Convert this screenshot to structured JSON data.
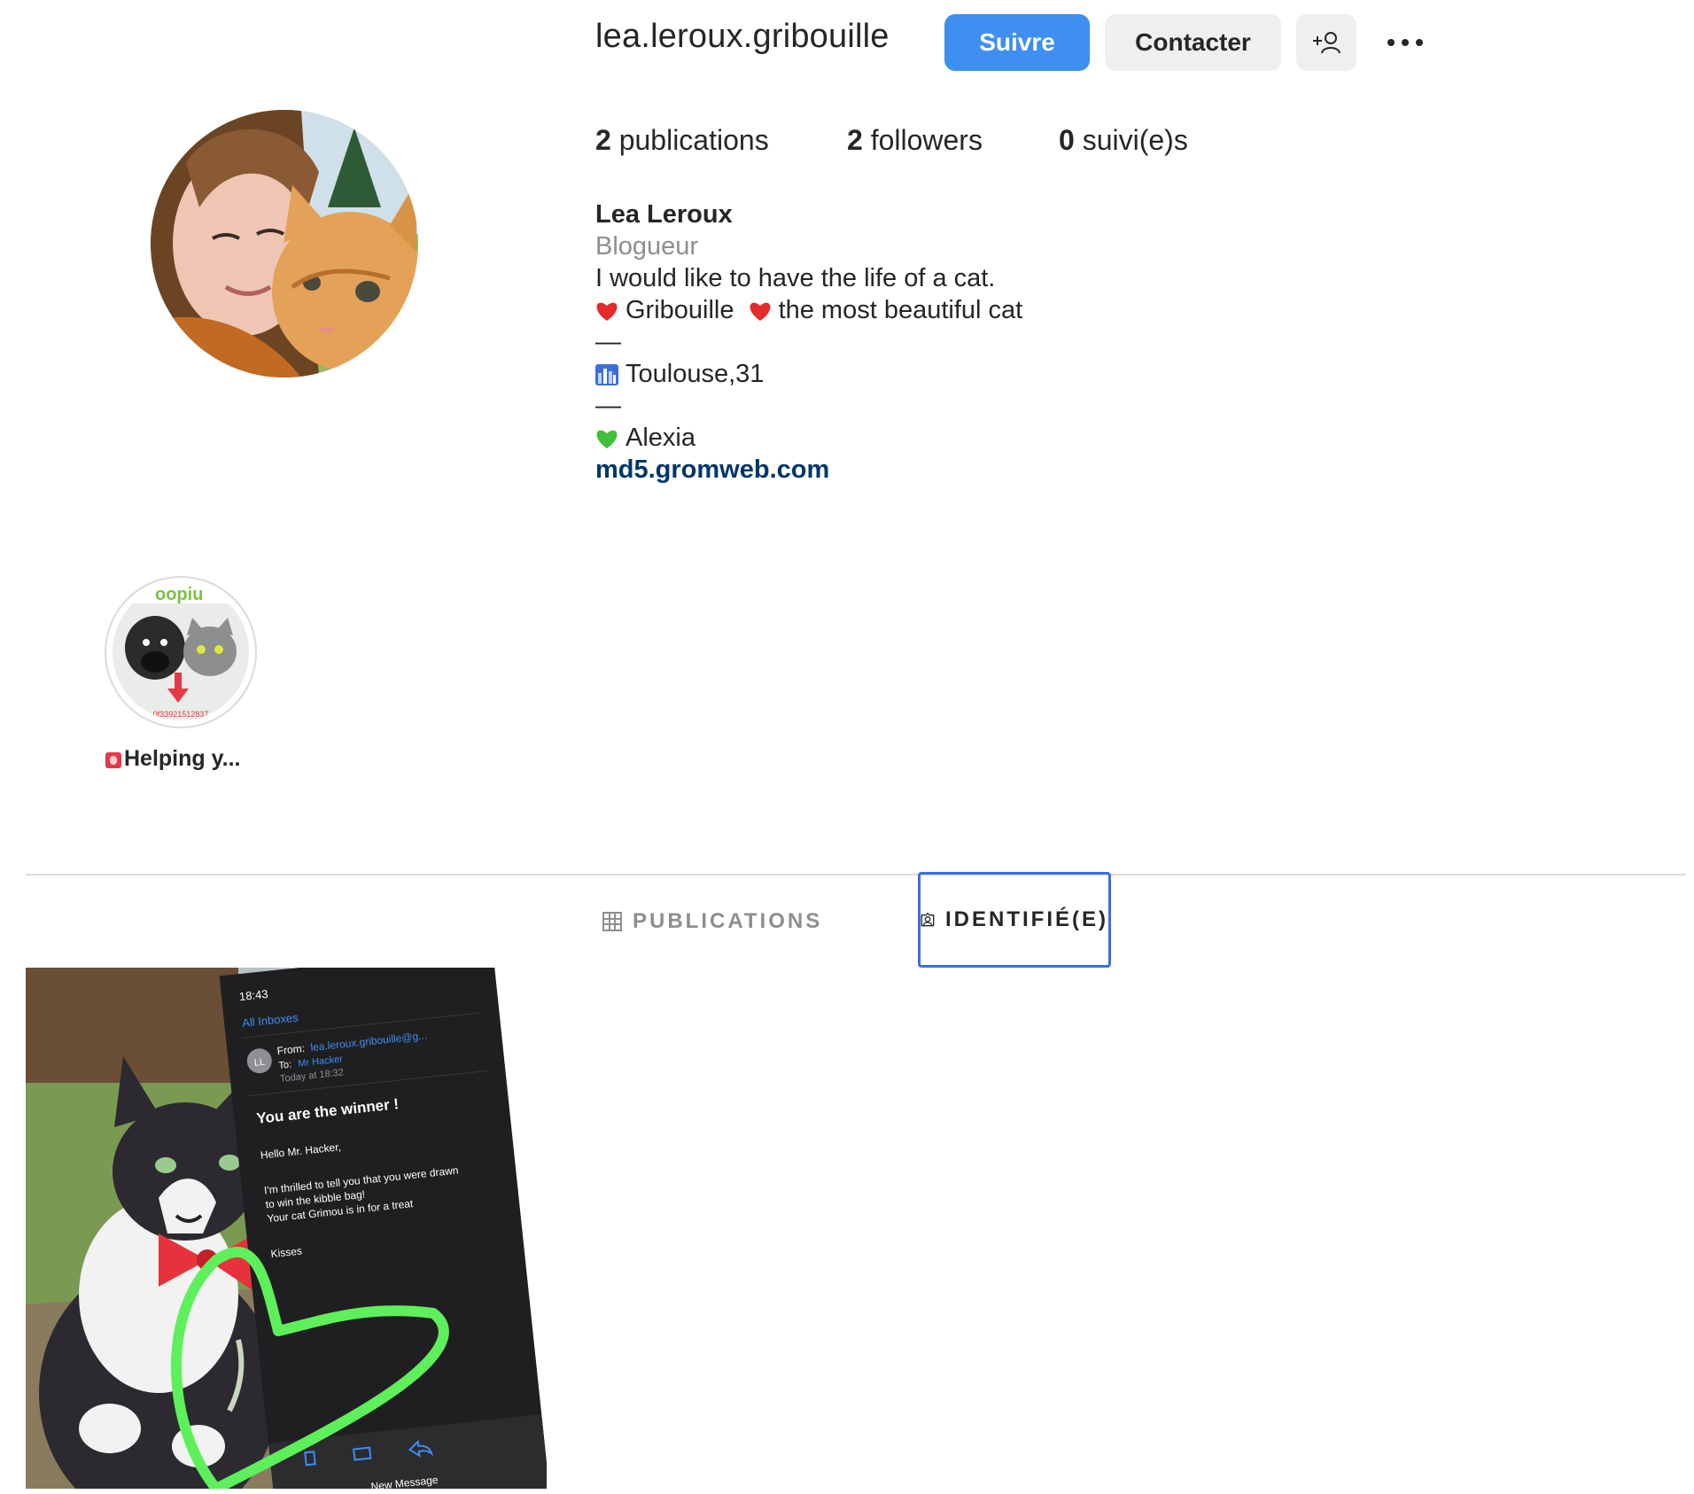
{
  "profile": {
    "username": "lea.leroux.gribouille",
    "follow_label": "Suivre",
    "contact_label": "Contacter",
    "add_user_icon": "add-user-icon",
    "more_icon": "more-options-icon"
  },
  "stats": {
    "posts_count": "2",
    "posts_label": " publications",
    "followers_count": "2",
    "followers_label": " followers",
    "following_count": "0",
    "following_label": " suivi(e)s"
  },
  "bio": {
    "full_name": "Lea Leroux",
    "category": "Blogueur",
    "line1": "I would like to have the life of a cat.",
    "line2_a": "Gribouille",
    "line2_b": "the most beautiful cat",
    "separator": "—",
    "location": "Toulouse,31",
    "partner": "Alexia",
    "website": "md5.gromweb.com"
  },
  "highlight": {
    "label": "Helping y...",
    "image_text": "0f33921512837"
  },
  "tabs": {
    "posts": "PUBLICATIONS",
    "tagged": "IDENTIFIÉ(E)"
  },
  "post": {
    "time": "18:43",
    "back": "All Inboxes",
    "avatar_initials": "LL",
    "from_label": "From:",
    "from_value": "lea.leroux.gribouille@g...",
    "to_label": "To:",
    "to_value": "Mr Hacker",
    "date": "Today at 18:32",
    "subject": "You are the winner !",
    "greeting": "Hello Mr. Hacker,",
    "body1": "I'm thrilled to tell you that you were drawn",
    "body2": "to win the kibble bag!",
    "body3": "Your cat Grimou is in for a treat",
    "sign": "Kisses",
    "new_message": "New Message"
  },
  "colors": {
    "follow_button": "#3f8ff0",
    "link": "#00376b",
    "tab_focus_outline": "#3a6fe0",
    "heart_overlay": "#5ef05a"
  }
}
